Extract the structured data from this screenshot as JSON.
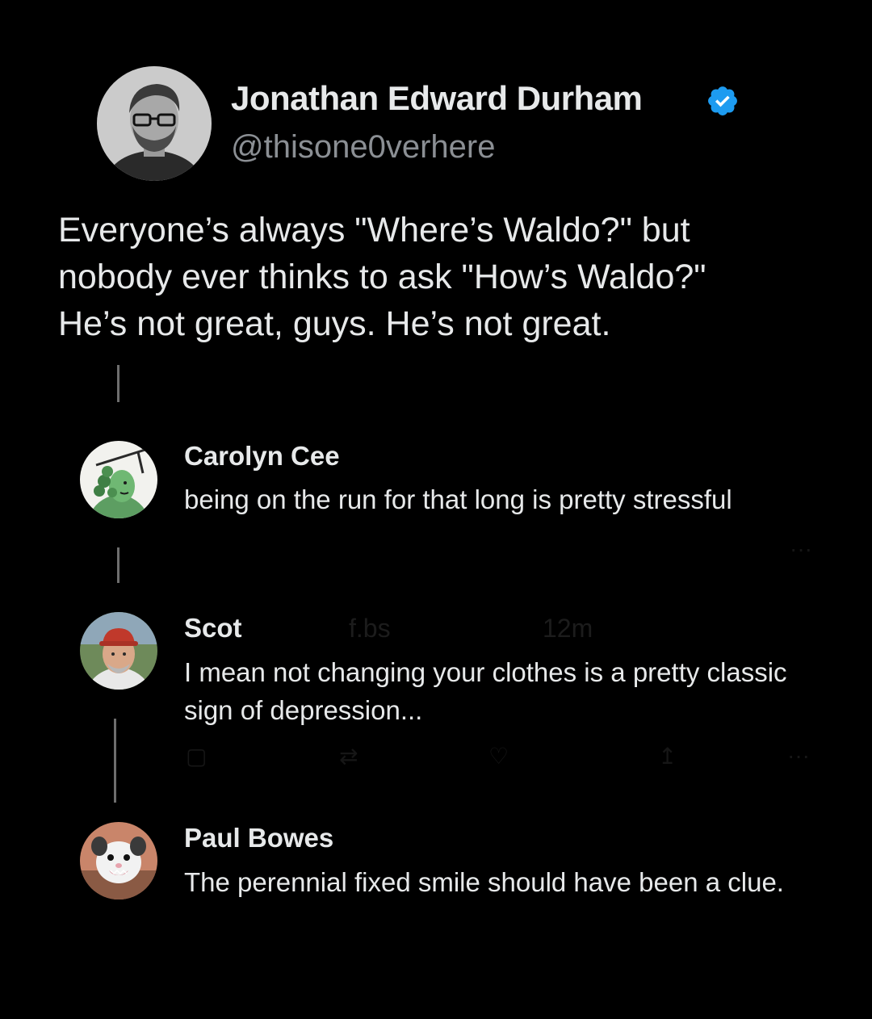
{
  "post": {
    "author_name": "Jonathan Edward Durham",
    "author_handle": "@thisone0verhere",
    "verified": true,
    "lines": [
      "Everyone’s always \"Where’s Waldo?\" but",
      "nobody ever thinks to ask \"How’s Waldo?\"",
      "He’s not great, guys. He’s not great."
    ],
    "avatar_icon": "avatar-man-glasses"
  },
  "replies": [
    {
      "name": "Carolyn Cee",
      "text": "being on the run for that long is pretty stressful",
      "avatar_icon": "avatar-medusa-illustration"
    },
    {
      "name": "Scot",
      "meta_handle": "f.bs",
      "meta_time": "12m",
      "text": "I mean not changing your clothes is a pretty classic sign of depression...",
      "avatar_icon": "avatar-man-red-cap"
    },
    {
      "name": "Paul Bowes",
      "text": "The perennial fixed smile should have been a clue.",
      "avatar_icon": "avatar-opossum"
    }
  ],
  "colors": {
    "background": "#000000",
    "text": "#e7e9ea",
    "handle": "#8b8f94",
    "verified": "#1d9bf0",
    "thread_line": "#6e6e6e"
  }
}
